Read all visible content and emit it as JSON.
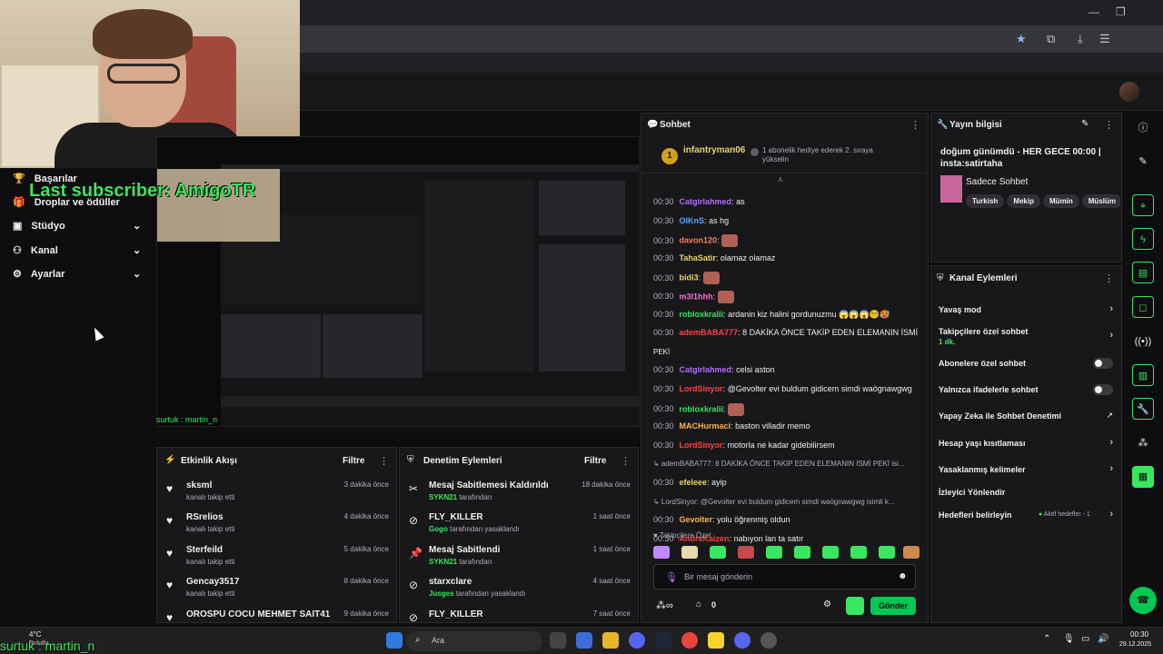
{
  "overlay": {
    "last_subscriber": "Last subscriber: AmigoTR",
    "bottom_name": "surtuk : martin_n",
    "preview_label": "surtuk : martin_n"
  },
  "nav": {
    "items": [
      {
        "label": "Başarılar",
        "icon": "trophy-icon"
      },
      {
        "label": "Droplar ve ödüller",
        "icon": "gift-icon"
      },
      {
        "label": "Stüdyo",
        "icon": "studio-icon"
      },
      {
        "label": "Kanal",
        "icon": "channel-icon"
      },
      {
        "label": "Ayarlar",
        "icon": "gear-icon"
      }
    ]
  },
  "activity": {
    "title": "Etkinlik Akışı",
    "filter": "Filtre",
    "rows": [
      {
        "name": "sksml",
        "sub": "kanalı takip etti",
        "time": "3 dakika önce"
      },
      {
        "name": "RSrelios",
        "sub": "kanalı takip etti",
        "time": "4 dakika önce"
      },
      {
        "name": "Sterfeild",
        "sub": "kanalı takip etti",
        "time": "5 dakika önce"
      },
      {
        "name": "Gencay3517",
        "sub": "kanalı takip etti",
        "time": "8 dakika önce"
      },
      {
        "name": "OROSPU COCU MEHMET SAIT41",
        "sub": "",
        "time": "9 dakika önce"
      }
    ]
  },
  "moderation": {
    "title": "Denetim Eylemleri",
    "filter": "Filtre",
    "rows": [
      {
        "action": "Mesaj Sabitlemesi Kaldırıldı",
        "user": "SYKN21",
        "rest": "tarafından",
        "time": "18 dakika önce"
      },
      {
        "action": "FLY_KILLER",
        "user": "Gogo",
        "rest": "tarafından yasaklandı",
        "time": "1 saat önce"
      },
      {
        "action": "Mesaj Sabitlendi",
        "user": "SYKN21",
        "rest": "tarafından",
        "time": "1 saat önce"
      },
      {
        "action": "starxclare",
        "user": "Jusges",
        "rest": "tarafından yasaklandı",
        "time": "4 saat önce"
      },
      {
        "action": "FLY_KILLER",
        "user": "",
        "rest": "",
        "time": "7 saat önce"
      }
    ]
  },
  "chat": {
    "title": "Sohbet",
    "pinned_user": "infantryman06",
    "pinned_count": "1",
    "pinned_text": "1 abonelik hediye ederek 2. sıraya yükselin",
    "messages": [
      {
        "time": "00:30",
        "user": "Catgirlahmed",
        "color": "#b36bff",
        "text": "as"
      },
      {
        "time": "00:30",
        "user": "OlKnS",
        "color": "#5aa7ff",
        "text": "as hg"
      },
      {
        "time": "00:30",
        "user": "davon120",
        "color": "#ff7a59",
        "text": ""
      },
      {
        "time": "00:30",
        "user": "TahaSatir",
        "color": "#e6d36b",
        "text": "olamaz olamaz"
      },
      {
        "time": "00:30",
        "user": "bidi3",
        "color": "#e6d36b",
        "text": ""
      },
      {
        "time": "00:30",
        "user": "m3l1hhh",
        "color": "#ff6bd6",
        "text": ""
      },
      {
        "time": "00:30",
        "user": "robloxkralii",
        "color": "#39e75f",
        "text": "ardanin kiz halini gordunuzmu 😱😱😱😵‍💫🥵"
      },
      {
        "time": "00:30",
        "user": "ademBABA777",
        "color": "#ff4040",
        "text": "8 DAKİKA ÖNCE TAKİP EDEN ELEMANIN İSMİ"
      },
      {
        "time": "",
        "user": "",
        "color": "#efeff1",
        "text": "PEKİ"
      },
      {
        "time": "00:30",
        "user": "Catgirlahmed",
        "color": "#b36bff",
        "text": "celsi aston"
      },
      {
        "time": "00:30",
        "user": "LordSinyor",
        "color": "#ff4040",
        "text": "@Gevolter evi buldum gidicem simdi waögnawgwg"
      },
      {
        "time": "00:30",
        "user": "robloxkralii",
        "color": "#39e75f",
        "text": ""
      },
      {
        "time": "00:30",
        "user": "MACHurmaci",
        "color": "#ffb347",
        "text": "baston villadir memo"
      },
      {
        "time": "00:30",
        "user": "LordSinyor",
        "color": "#ff4040",
        "text": "motorla ne kadar gidebilirsem"
      },
      {
        "time": "",
        "user": "",
        "color": "#adadb8",
        "text": "↳ ademBABA777: 8 DAKİKA ÖNCE TAKİP EDEN ELEMANIN İSMİ PEKİ isi..."
      },
      {
        "time": "00:30",
        "user": "efeleee",
        "color": "#e6d36b",
        "text": "ayip"
      },
      {
        "time": "",
        "user": "",
        "color": "#adadb8",
        "text": "↳ LordSinyor: @Gevolter evi buldum gidicem simdi waögnawgwg isimli k..."
      },
      {
        "time": "00:30",
        "user": "Gevolter",
        "color": "#ffb347",
        "text": "yolu öğrenmiş oldun"
      },
      {
        "time": "00:30",
        "user": "AndreKaizen",
        "color": "#ff4040",
        "text": "nabıyon lan ta satır"
      }
    ],
    "followers_label": "Takipçilere Özel",
    "input_placeholder": "Bir mesaj gönderin",
    "points": "0",
    "send_label": "Gönder"
  },
  "info": {
    "title": "Yayın bilgisi",
    "stream_title": "doğum günümdü - HER GECE 00:00 | insta:satirtaha",
    "category": "Sadece Sohbet",
    "tags": [
      "Turkish",
      "Mekip",
      "Mümin",
      "Müslüm"
    ]
  },
  "actions": {
    "title": "Kanal Eylemleri",
    "items": [
      {
        "label": "Yavaş mod",
        "kind": "chevron"
      },
      {
        "label": "Takipçilere özel sohbet",
        "sub": "1 dk.",
        "kind": "chevron"
      },
      {
        "label": "Abonelere özel sohbet",
        "kind": "toggle"
      },
      {
        "label": "Yalnızca ifadelerle sohbet",
        "kind": "toggle"
      },
      {
        "label": "Yapay Zeka ile Sohbet Denetimi",
        "kind": "external"
      },
      {
        "label": "Hesap yaşı kısıtlaması",
        "kind": "chevron"
      },
      {
        "label": "Yasaklanmış kelimeler",
        "kind": "chevron"
      },
      {
        "label": "İzleyici Yönlendir",
        "kind": "none"
      },
      {
        "label": "Hedefleri belirleyin",
        "kind": "chevron",
        "extra": "Aktif hedefler - 1"
      }
    ]
  },
  "taskbar": {
    "weather_temp": "4°C",
    "weather_desc": "Bulutlu",
    "search": "Ara",
    "time": "00:30",
    "date": "29.12.2025"
  },
  "colors": {
    "accent": "#39e75f",
    "panel": "#18181b",
    "bg": "#0e0e10"
  }
}
